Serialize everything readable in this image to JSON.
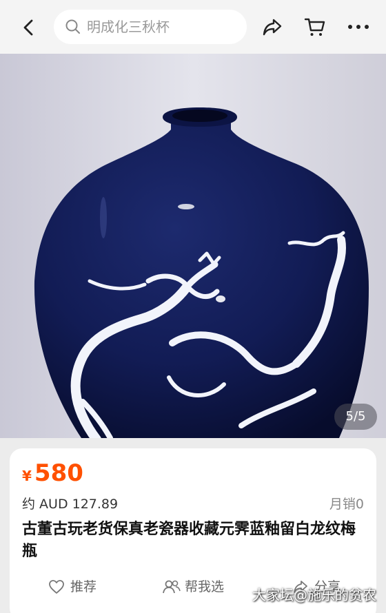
{
  "header": {
    "search_text": "明成化三秋杯",
    "icons": [
      "back-arrow-icon",
      "search-icon",
      "share-icon",
      "cart-icon",
      "more-icon"
    ]
  },
  "gallery": {
    "counter": "5/5",
    "image_subject": "cobalt blue meiping vase with white dragon"
  },
  "product": {
    "currency_symbol": "¥",
    "price": "580",
    "converted_price": "约 AUD 127.89",
    "monthly_sales": "月销0",
    "title": "古董古玩老货保真老瓷器收藏元霁蓝釉留白龙纹梅瓶"
  },
  "actions": {
    "recommend": "推荐",
    "help_choose": "帮我选",
    "share": "分享"
  },
  "watermark": "大家坛@施乐的贫农",
  "colors": {
    "price": "#ff5000",
    "vase_blue": "#0f1a4a",
    "background": "#ececec"
  }
}
